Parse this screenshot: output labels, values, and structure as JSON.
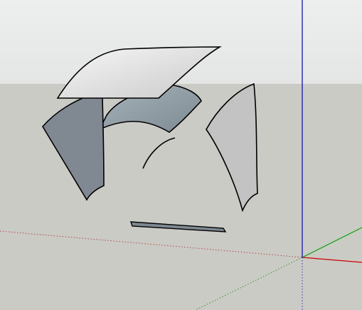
{
  "viewport": {
    "sky_color": "#edeeee",
    "sky_gradient_bottom": "#e4e6e6",
    "ground_color": "#cbcbc6"
  },
  "axes": {
    "red_axis_color": "#cc0000",
    "green_axis_color": "#00a000",
    "blue_axis_color": "#0000cc",
    "dotted_red_color": "#b44848",
    "dotted_green_color": "#2f9d2f",
    "dotted_blue_color": "#2e2ec2"
  },
  "faces": {
    "top_panel_light": "#f7f7f7",
    "top_panel_dark": "#c9c9c9",
    "left_panel": "#808891",
    "back_panel_light": "#a7b3bb",
    "back_panel_dark": "#7d8a92",
    "right_panel": "#c3c3c3",
    "flat_strip": "#7d8890",
    "edge_color": "#000000"
  }
}
